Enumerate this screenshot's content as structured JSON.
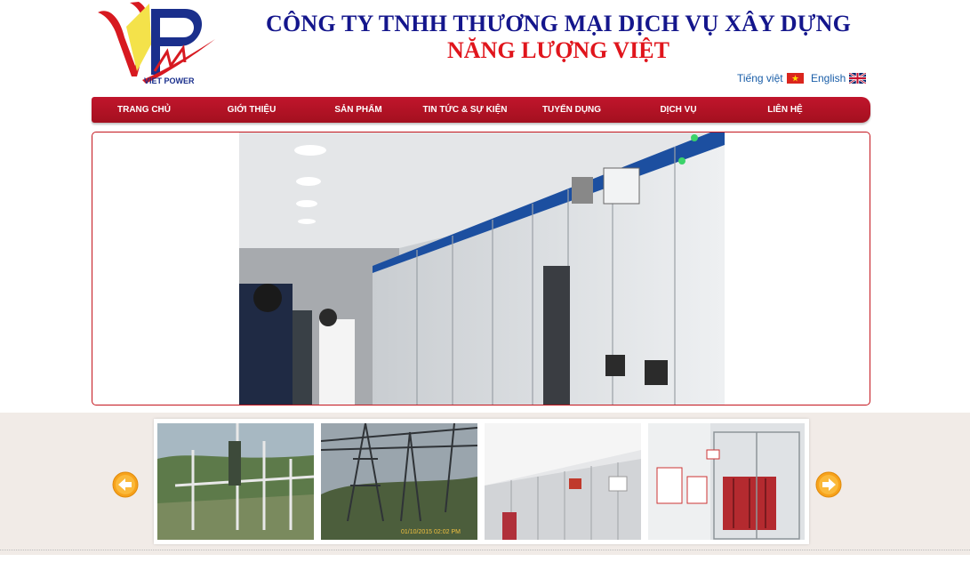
{
  "logo": {
    "text": "VIET POWER"
  },
  "company": {
    "line1": "CÔNG TY TNHH THƯƠNG MẠI DỊCH VỤ XÂY DỰNG",
    "line2": "NĂNG LƯỢNG VIỆT"
  },
  "languages": [
    {
      "label": "Tiếng việt",
      "flag": "vietnam-flag"
    },
    {
      "label": "English",
      "flag": "uk-flag"
    }
  ],
  "nav": {
    "items": [
      "TRANG CHỦ",
      "GIỚI THIỆU",
      "SẢN PHẨM",
      "TIN TỨC & SỰ KIỆN",
      "TUYỂN DỤNG",
      "DỊCH VỤ",
      "LIÊN HỆ"
    ]
  },
  "colors": {
    "brand_blue": "#14168c",
    "brand_red": "#e0151c",
    "nav_red": "#b8132a",
    "arrow_orange": "#f7a21b"
  },
  "gallery": {
    "thumbnails": [
      {
        "name": "substation-outdoor"
      },
      {
        "name": "substation-towers",
        "caption": "01/10/2015 02:02 PM"
      },
      {
        "name": "switchgear-room"
      },
      {
        "name": "transformer-cage"
      }
    ]
  },
  "icons": {
    "prev": "arrow-left-icon",
    "next": "arrow-right-icon"
  }
}
